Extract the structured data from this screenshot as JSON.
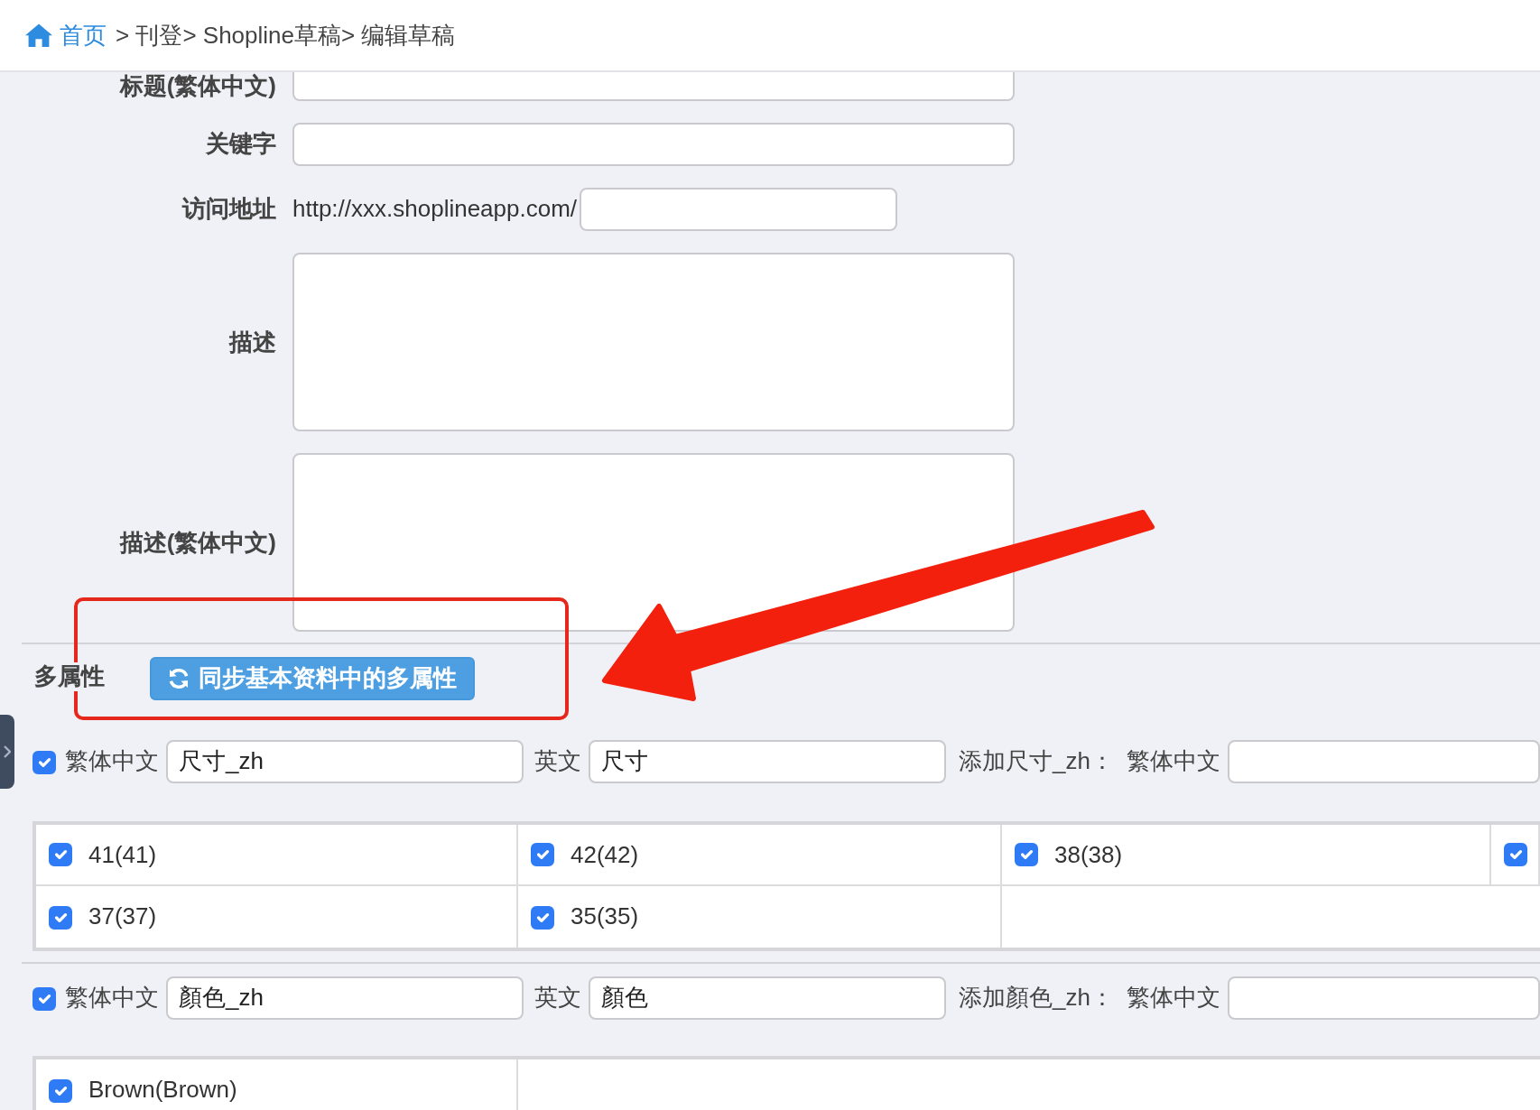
{
  "breadcrumb": {
    "home": "首页",
    "trail": "> 刊登> Shopline草稿> 编辑草稿"
  },
  "form_fields": [
    {
      "kind": "text",
      "label": "标题(繁体中文)"
    },
    {
      "kind": "text",
      "label": "关键字"
    },
    {
      "kind": "url",
      "label": "访问地址",
      "prefix": "http://xxx.shoplineapp.com/"
    },
    {
      "kind": "textarea",
      "label": "描述"
    },
    {
      "kind": "textarea",
      "label": "描述(繁体中文)"
    }
  ],
  "multi_attributes": {
    "label": "多属性",
    "sync_button": "同步基本资料中的多属性",
    "attributes": [
      {
        "checked": true,
        "zh_label": "繁体中文",
        "zh_value": "尺寸_zh",
        "en_label": "英文",
        "en_value": "尺寸",
        "add_label": "添加尺寸_zh：",
        "add_zh_label": "繁体中文",
        "options": [
          {
            "label": "41(41)",
            "checked": true
          },
          {
            "label": "42(42)",
            "checked": true
          },
          {
            "label": "38(38)",
            "checked": true
          },
          {
            "checked": true
          },
          {
            "label": "37(37)",
            "checked": true
          },
          {
            "label": "35(35)",
            "checked": true
          }
        ]
      },
      {
        "checked": true,
        "zh_label": "繁体中文",
        "zh_value": "顏色_zh",
        "en_label": "英文",
        "en_value": "顏色",
        "add_label": "添加顏色_zh：",
        "add_zh_label": "繁体中文",
        "options": [
          {
            "label": "Brown(Brown)",
            "checked": true
          }
        ]
      }
    ]
  }
}
